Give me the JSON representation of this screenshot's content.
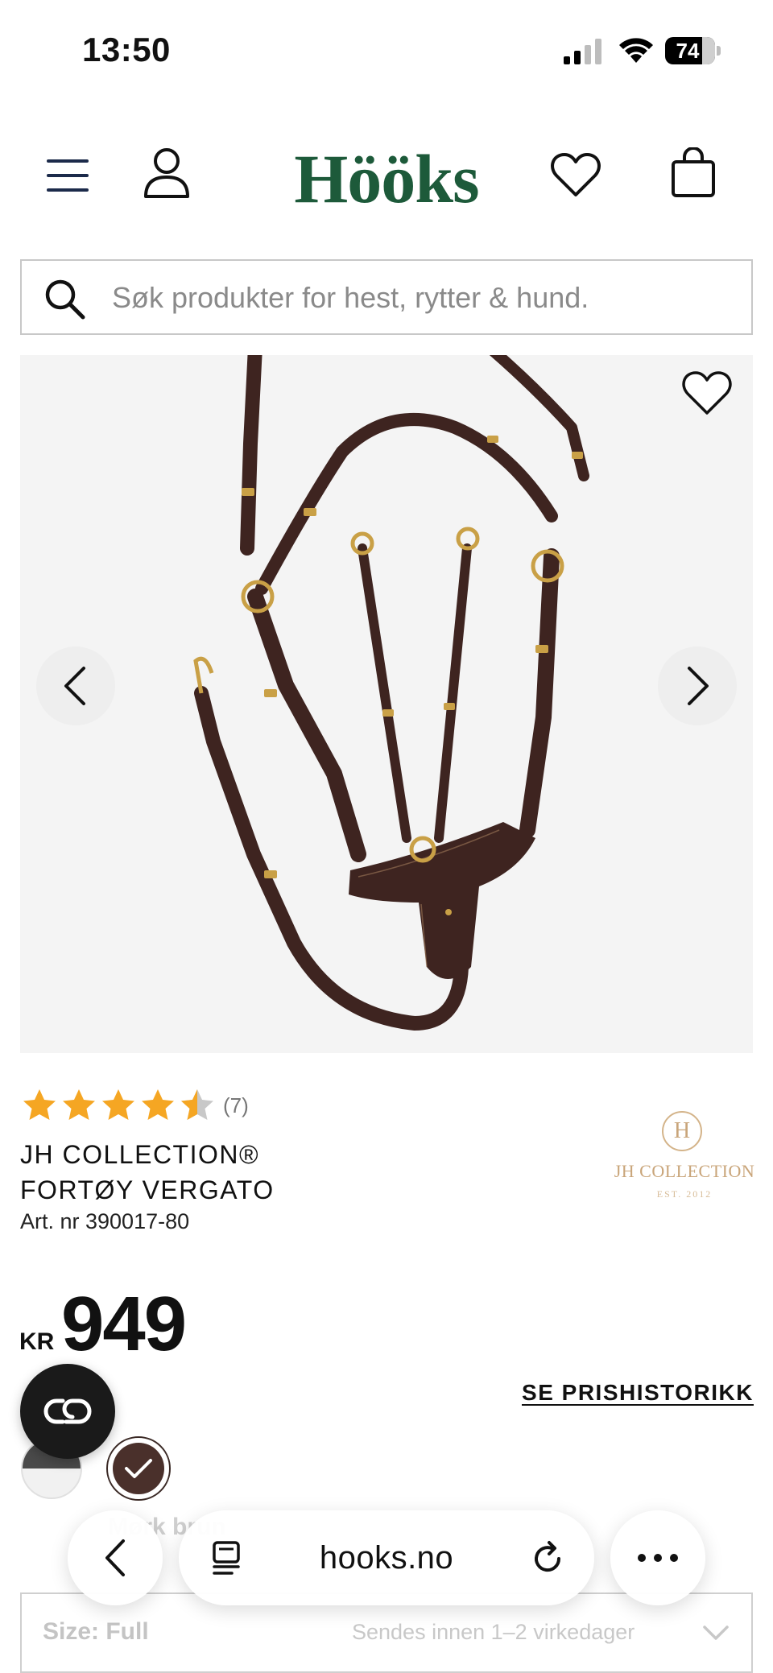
{
  "status_bar": {
    "time": "13:50",
    "battery": "74"
  },
  "header": {
    "logo": "Hööks"
  },
  "search": {
    "placeholder": "Søk produkter for hest, rytter & hund."
  },
  "product": {
    "rating": 4.5,
    "review_count": "(7)",
    "title_line1": "JH COLLECTION®",
    "title_line2": "FORTØY VERGATO",
    "art_nr": "Art. nr 390017-80",
    "brand": {
      "monogram": "H",
      "name": "JH COLLECTION",
      "est": "EST. 2012"
    },
    "currency": "KR",
    "price": "949",
    "price_history_link": "SE PRISHISTORIKK",
    "color_label": "Mørk brun",
    "colors": [
      {
        "name": "black-white",
        "selected": false
      },
      {
        "name": "dark-brown",
        "selected": true,
        "hex": "#4a302b"
      }
    ],
    "size": "Size: Full",
    "shipping": "Sendes innen 1–2 virkedager"
  },
  "browser": {
    "url": "hooks.no"
  },
  "colors": {
    "brand_green": "#1d5a3a",
    "star": "#f5a623",
    "leather": "#3e2420"
  }
}
